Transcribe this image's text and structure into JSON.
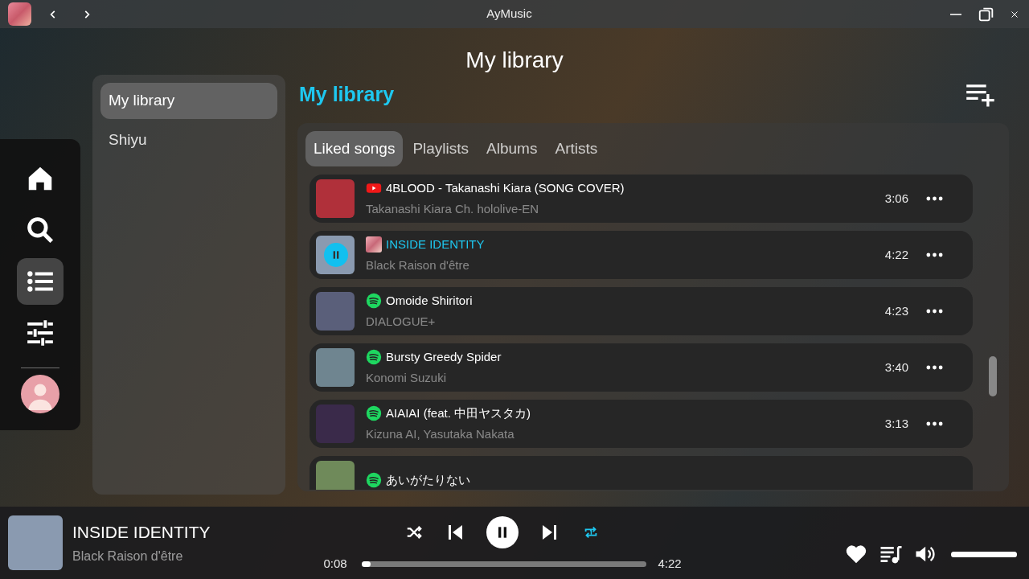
{
  "window": {
    "title": "AyMusic"
  },
  "page_title": "My library",
  "nav": [
    {
      "kind": "home",
      "selected": false
    },
    {
      "kind": "search",
      "selected": false
    },
    {
      "kind": "library",
      "selected": true
    },
    {
      "kind": "equalizer",
      "selected": false
    }
  ],
  "libraries": [
    {
      "label": "My library",
      "selected": true
    },
    {
      "label": "Shiyu",
      "selected": false
    }
  ],
  "section_title": "My library",
  "tabs": [
    {
      "label": "Liked songs",
      "selected": true
    },
    {
      "label": "Playlists",
      "selected": false
    },
    {
      "label": "Albums",
      "selected": false
    },
    {
      "label": "Artists",
      "selected": false
    }
  ],
  "songs": [
    {
      "title": "4BLOOD - Takanashi Kiara (SONG COVER)",
      "artist": "Takanashi Kiara Ch. hololive-EN",
      "duration": "3:06",
      "kind": "youtube",
      "playing": false,
      "color": "#b0303a"
    },
    {
      "title": "INSIDE IDENTITY",
      "artist": "Black Raison d'être",
      "duration": "4:22",
      "kind": "local",
      "playing": true,
      "color": "#8a9ab0"
    },
    {
      "title": "Omoide Shiritori",
      "artist": "DIALOGUE+",
      "duration": "4:23",
      "kind": "spotify",
      "playing": false,
      "color": "#5a5f7a"
    },
    {
      "title": "Bursty Greedy Spider",
      "artist": "Konomi Suzuki",
      "duration": "3:40",
      "kind": "spotify",
      "playing": false,
      "color": "#6f8590"
    },
    {
      "title": "AIAIAI (feat. 中田ヤスタカ)",
      "artist": "Kizuna AI, Yasutaka Nakata",
      "duration": "3:13",
      "kind": "spotify",
      "playing": false,
      "color": "#3a2a4a"
    },
    {
      "title": "あいがたりない",
      "kind": "spotify",
      "playing": false,
      "color": "#6f8a5a"
    }
  ],
  "player": {
    "title": "INSIDE IDENTITY",
    "artist": "Black Raison d'être",
    "elapsed": "0:08",
    "total": "4:22",
    "level": 0.03,
    "playing": true,
    "shuffle": false,
    "repeat_one": true,
    "liked": true,
    "volume": {
      "level": 1
    }
  }
}
